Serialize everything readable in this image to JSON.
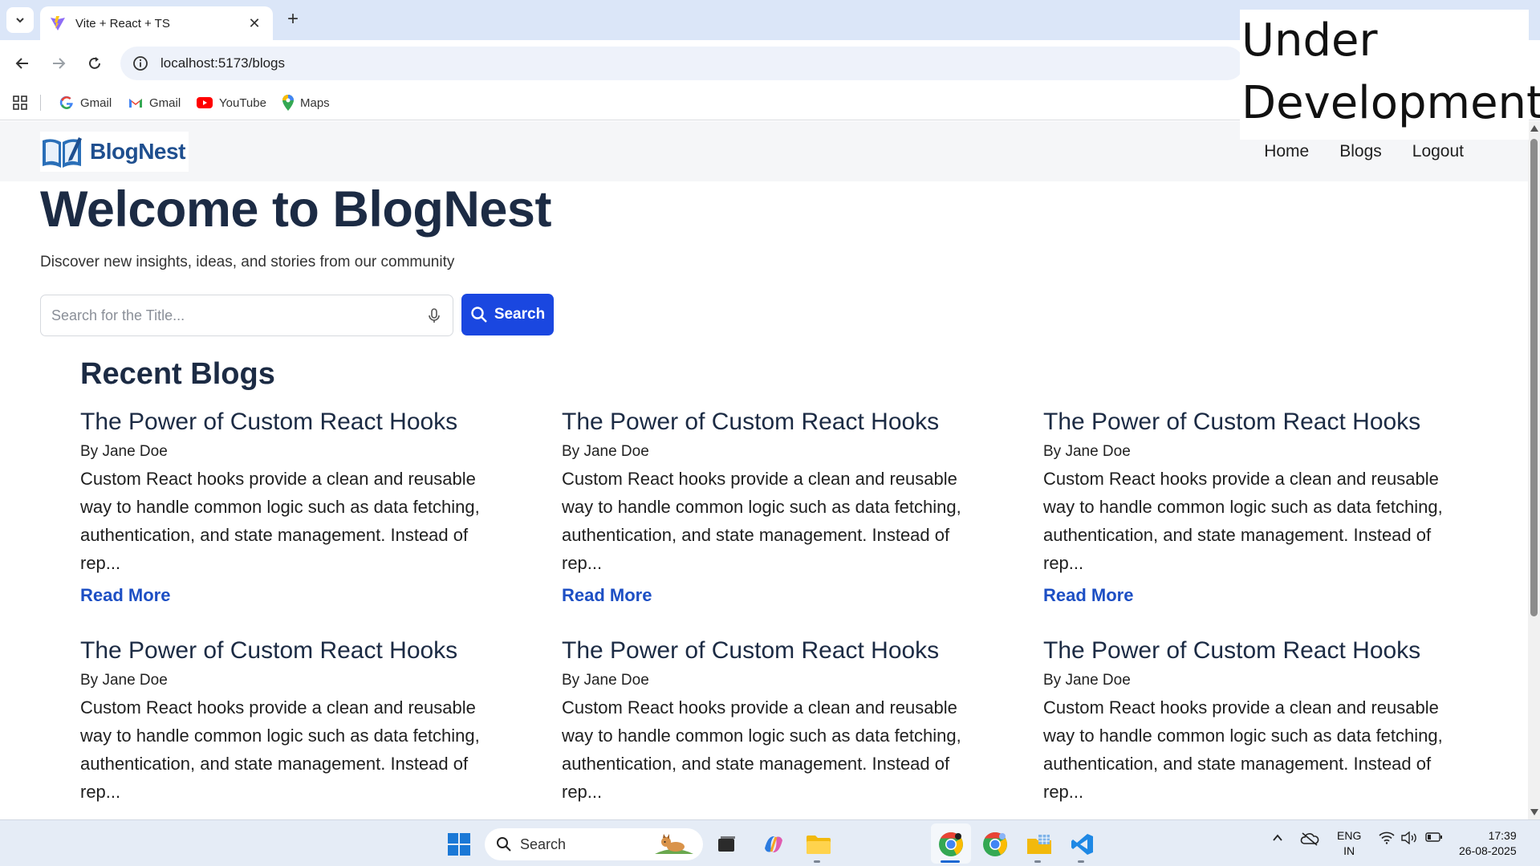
{
  "browser": {
    "tab_title": "Vite + React + TS",
    "url": "localhost:5173/blogs",
    "bookmarks": [
      "Gmail",
      "Gmail",
      "YouTube",
      "Maps"
    ]
  },
  "overlay": {
    "line1": "Under",
    "line2": "Development"
  },
  "site": {
    "logo_text": "BlogNest",
    "nav": [
      "Home",
      "Blogs",
      "Logout"
    ],
    "hero_title": "Welcome to BlogNest",
    "hero_subtitle": "Discover new insights, ideas, and stories from our community",
    "search_placeholder": "Search for the Title...",
    "search_button": "Search",
    "recent_title": "Recent Blogs",
    "posts": [
      {
        "title": "The Power of Custom React Hooks",
        "author": "By Jane Doe",
        "excerpt": "Custom React hooks provide a clean and reusable way to handle common logic such as data fetching, authentication, and state management. Instead of rep...",
        "more": "Read More"
      },
      {
        "title": "The Power of Custom React Hooks",
        "author": "By Jane Doe",
        "excerpt": "Custom React hooks provide a clean and reusable way to handle common logic such as data fetching, authentication, and state management. Instead of rep...",
        "more": "Read More"
      },
      {
        "title": "The Power of Custom React Hooks",
        "author": "By Jane Doe",
        "excerpt": "Custom React hooks provide a clean and reusable way to handle common logic such as data fetching, authentication, and state management. Instead of rep...",
        "more": "Read More"
      },
      {
        "title": "The Power of Custom React Hooks",
        "author": "By Jane Doe",
        "excerpt": "Custom React hooks provide a clean and reusable way to handle common logic such as data fetching, authentication, and state management. Instead of rep...",
        "more": ""
      },
      {
        "title": "The Power of Custom React Hooks",
        "author": "By Jane Doe",
        "excerpt": "Custom React hooks provide a clean and reusable way to handle common logic such as data fetching, authentication, and state management. Instead of rep...",
        "more": ""
      },
      {
        "title": "The Power of Custom React Hooks",
        "author": "By Jane Doe",
        "excerpt": "Custom React hooks provide a clean and reusable way to handle common logic such as data fetching, authentication, and state management. Instead of rep...",
        "more": ""
      }
    ]
  },
  "taskbar": {
    "search_label": "Search",
    "lang_line1": "ENG",
    "lang_line2": "IN",
    "time": "17:39",
    "date": "26-08-2025"
  },
  "colors": {
    "accent": "#1a47e0",
    "link": "#1d4fc4",
    "heading": "#1c2b44"
  }
}
